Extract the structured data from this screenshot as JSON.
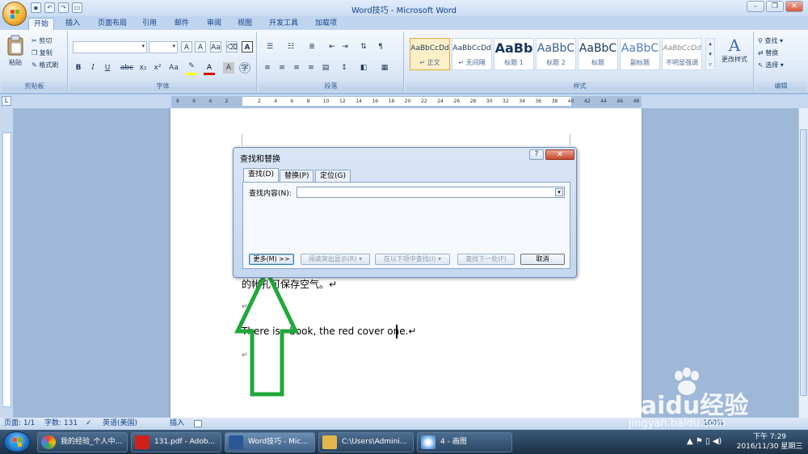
{
  "window": {
    "title": "Word技巧 - Microsoft Word"
  },
  "ribbon_tabs": [
    "开始",
    "插入",
    "页面布局",
    "引用",
    "邮件",
    "审阅",
    "视图",
    "开发工具",
    "加载项"
  ],
  "clipboard": {
    "paste": "粘贴",
    "cut": "剪切",
    "copy": "复制",
    "format_painter": "格式刷",
    "label": "剪贴板"
  },
  "font": {
    "bold": "B",
    "italic": "I",
    "underline": "U",
    "strike": "abc",
    "sub": "x₂",
    "sup": "x²",
    "case": "Aa",
    "label": "字体"
  },
  "paragraph": {
    "label": "段落"
  },
  "styles": {
    "items": [
      {
        "preview": "AaBbCcDd",
        "name": "↵ 正文"
      },
      {
        "preview": "AaBbCcDd",
        "name": "↵ 无间隔"
      },
      {
        "preview": "AaBb",
        "name": "标题 1"
      },
      {
        "preview": "AaBbC",
        "name": "标题 2"
      },
      {
        "preview": "AaBbC",
        "name": "标题"
      },
      {
        "preview": "AaBbC",
        "name": "副标题"
      },
      {
        "preview": "AaBbCcDd",
        "name": "不明显强调"
      }
    ],
    "change_styles": "更改样式",
    "label": "样式"
  },
  "editing": {
    "find": "查找",
    "replace": "替换",
    "select": "选择",
    "label": "编辑"
  },
  "ruler": {
    "ticks": [
      "8",
      "6",
      "4",
      "2",
      "",
      "2",
      "4",
      "6",
      "8",
      "10",
      "12",
      "14",
      "16",
      "18",
      "20",
      "22",
      "24",
      "26",
      "28",
      "30",
      "32",
      "34",
      "36",
      "38",
      "40",
      "42",
      "44",
      "46",
      "48"
    ]
  },
  "document": {
    "line1_blurred": "",
    "line2": "的帐孔可保存空气。↵",
    "line3": "↵",
    "line4": "There is   book, the red cover one.↵",
    "line5": "↵"
  },
  "dialog": {
    "title": "查找和替换",
    "help": "?",
    "close": "✕",
    "tabs": [
      "查找(D)",
      "替换(P)",
      "定位(G)"
    ],
    "find_label": "查找内容(N):",
    "find_value": "",
    "buttons": {
      "more": "更多(M) >>",
      "reading_highlight": "阅读突出显示(R) ▾",
      "find_in": "在以下项中查找(I) ▾",
      "find_next": "查找下一处(F)",
      "cancel": "取消"
    }
  },
  "status": {
    "page": "页面: 1/1",
    "words": "字数: 131",
    "lang": "英语(美国)",
    "insert": "插入",
    "zoom": "100%"
  },
  "taskbar": {
    "items": [
      "我的经验_个人中...",
      "131.pdf - Adob...",
      "Word技巧 - Mic...",
      "C:\\Users\\Admini...",
      "4 - 画图"
    ],
    "time": "下午 7:29",
    "date": "2016/11/30 星期三"
  },
  "watermark": {
    "brand": "Baidu经验",
    "url": "jingyan.baidu.com"
  },
  "colors": {
    "accent": "#2b5797",
    "arrow": "#1fa83a",
    "ribbon": "#dce8f7"
  }
}
